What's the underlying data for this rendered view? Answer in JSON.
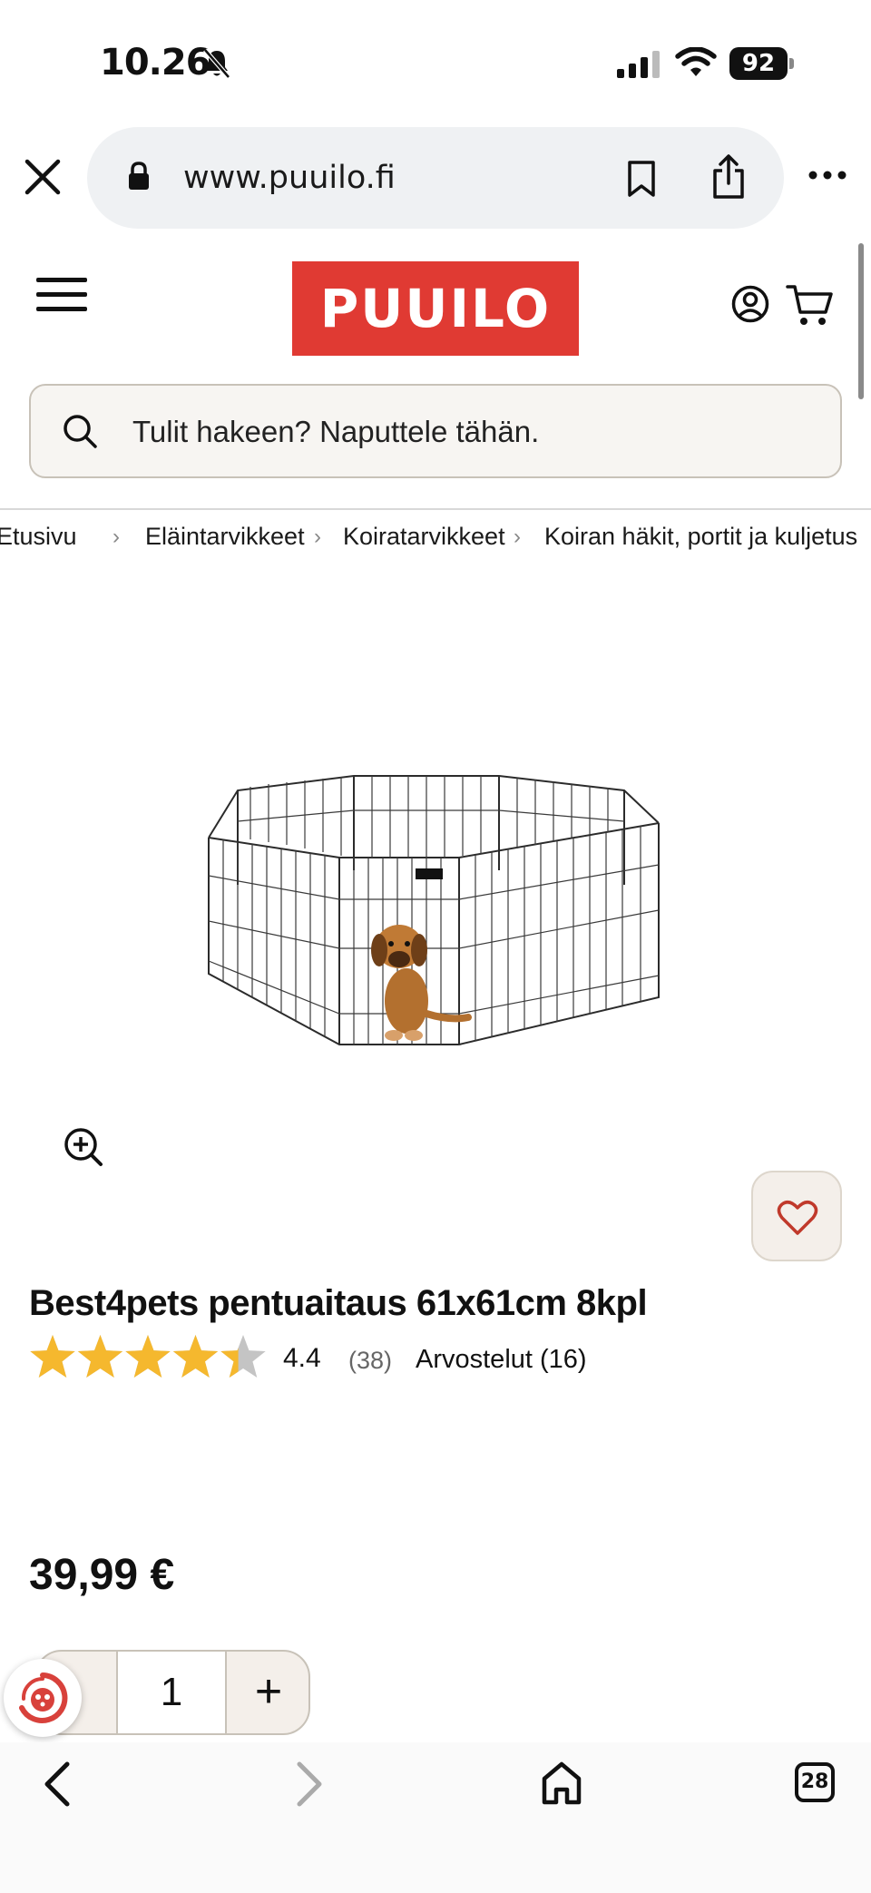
{
  "status_bar": {
    "time": "10.26",
    "battery": "92",
    "icons": [
      "bell-muted-icon",
      "cellular-signal-icon",
      "wifi-icon",
      "battery-icon"
    ]
  },
  "browser": {
    "url": "www.puuilo.fi",
    "icons": [
      "close-icon",
      "lock-icon",
      "bookmark-icon",
      "share-icon",
      "more-icon"
    ]
  },
  "site": {
    "logo_text": "PUUILO",
    "brand_color": "#e03a33",
    "search_placeholder": "Tulit hakeen? Naputtele tähän."
  },
  "breadcrumb": [
    "Etusivu",
    "Eläintarvikkeet",
    "Koiratarvikkeet",
    "Koiran häkit, portit ja kuljetus"
  ],
  "product": {
    "title": "Best4pets pentuaitaus 61x61cm 8kpl",
    "rating_value": "4.4",
    "rating_fraction": 0.88,
    "rating_count": "(38)",
    "reviews_link": "Arvostelut (16)",
    "price": "39,99 €",
    "quantity": "1",
    "minus_label": "-",
    "plus_label": "+",
    "cage_label": "Best4pets"
  },
  "toolbar": {
    "tabs_count": "28",
    "icons": [
      "back-icon",
      "forward-icon",
      "home-icon",
      "tabs-icon"
    ]
  }
}
